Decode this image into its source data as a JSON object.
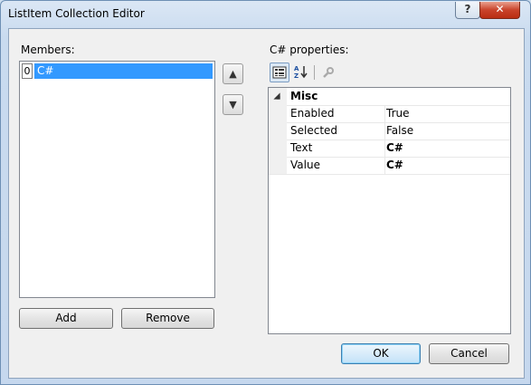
{
  "window": {
    "title": "ListItem Collection Editor",
    "help": "?",
    "close": "✕"
  },
  "members": {
    "label": "Members:",
    "items": [
      {
        "index": "0",
        "text": "C#"
      }
    ],
    "add_label": "Add",
    "remove_label": "Remove",
    "move_up": "▲",
    "move_down": "▼"
  },
  "properties": {
    "label": "C# properties:",
    "category": "Misc",
    "rows": [
      {
        "name": "Enabled",
        "value": "True",
        "bold": false
      },
      {
        "name": "Selected",
        "value": "False",
        "bold": false
      },
      {
        "name": "Text",
        "value": "C#",
        "bold": true
      },
      {
        "name": "Value",
        "value": "C#",
        "bold": true
      }
    ],
    "toolbar": {
      "categorized_icon": "categorized-icon",
      "alphabetical_icon": "alphabetical-icon",
      "property_pages_icon": "wrench-icon"
    }
  },
  "footer": {
    "ok_label": "OK",
    "cancel_label": "Cancel"
  }
}
